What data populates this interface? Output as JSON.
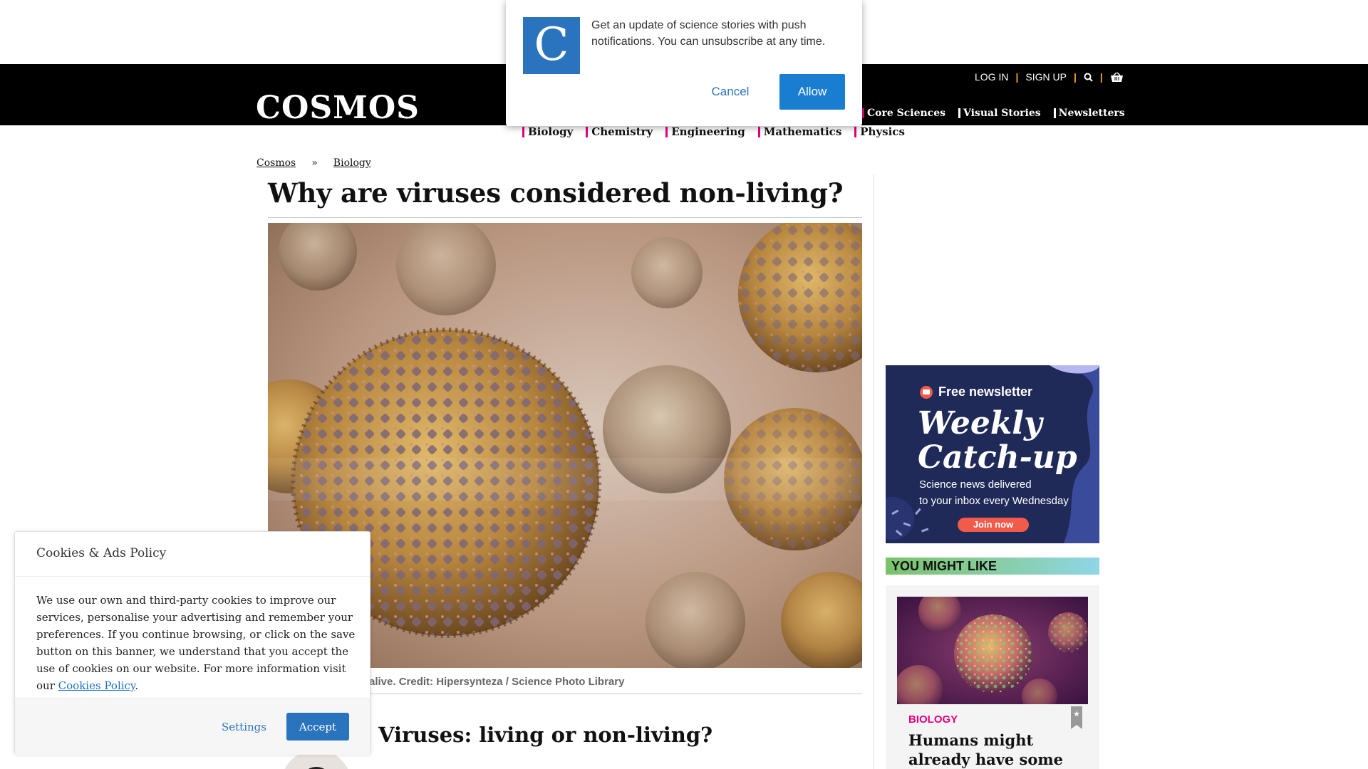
{
  "header": {
    "logo": "COSMOS",
    "login": "LOG IN",
    "signup": "SIGN UP",
    "nav": [
      "Core Sciences",
      "Visual Stories",
      "Newsletters"
    ],
    "subnav": [
      "Biology",
      "Chemistry",
      "Engineering",
      "Mathematics",
      "Physics"
    ]
  },
  "breadcrumb": [
    "Cosmos",
    "»",
    "Biology"
  ],
  "article": {
    "title": "Why are viruses considered non-living?",
    "caption": "alive. Credit: Hipersynteza / Science Photo Library",
    "subhead": "Viruses: living or non-living?"
  },
  "side_ad": {
    "free_label": "Free newsletter",
    "title_line1": "Weekly",
    "title_line2": "Catch-up",
    "sub_line1": "Science news delivered",
    "sub_line2": "to your inbox every Wednesday",
    "cta": "Join now"
  },
  "you_might_like": {
    "heading": "YOU MIGHT LIKE",
    "category": "BIOLOGY",
    "title": "Humans might already have some"
  },
  "push_prompt": {
    "logo_letter": "C",
    "text": "Get an update of science stories with push notifications. You can unsubscribe at any time.",
    "cancel": "Cancel",
    "allow": "Allow"
  },
  "cookie_banner": {
    "title": "Cookies & Ads Policy",
    "body": "We use our own and third-party cookies to improve our services, personalise your advertising and remember your preferences. If you continue browsing, or click on the save button on this banner, we understand that you accept the use of cookies on our website. For more information visit our",
    "link": "Cookies Policy",
    "period": ".",
    "settings": "Settings",
    "accept": "Accept"
  },
  "colors": {
    "accent_pink": "#e6007e",
    "brand_blue": "#2a74bd",
    "header_black": "#000000",
    "separator_orange": "#f5a623"
  }
}
